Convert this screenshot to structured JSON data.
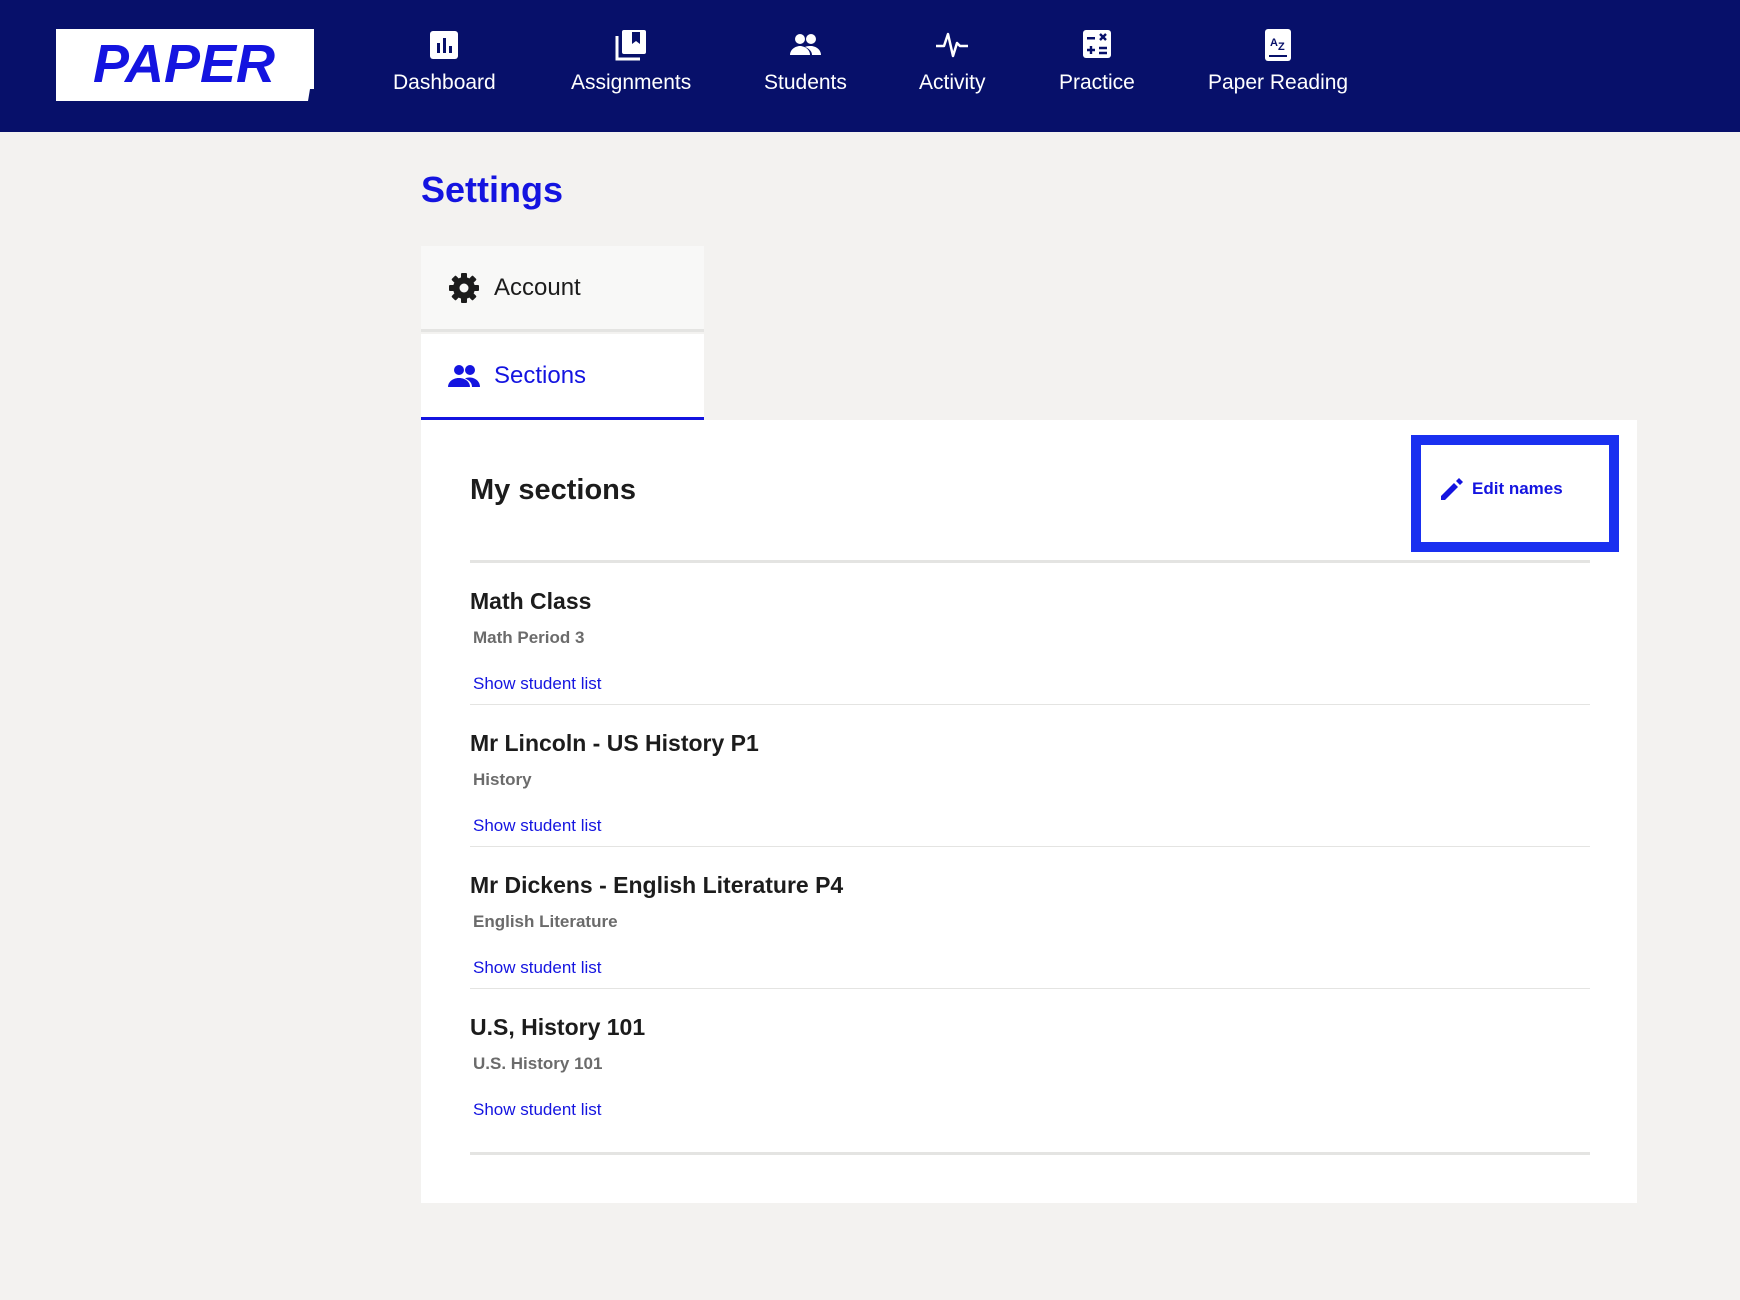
{
  "brand": {
    "logo_text": "PAPER"
  },
  "nav": {
    "items": [
      {
        "label": "Dashboard",
        "icon": "dashboard-chart-icon"
      },
      {
        "label": "Assignments",
        "icon": "assignments-book-icon"
      },
      {
        "label": "Students",
        "icon": "students-people-icon"
      },
      {
        "label": "Activity",
        "icon": "activity-pulse-icon"
      },
      {
        "label": "Practice",
        "icon": "practice-calculator-icon"
      },
      {
        "label": "Paper Reading",
        "icon": "reading-book-az-icon"
      }
    ]
  },
  "page": {
    "title": "Settings"
  },
  "settings_tabs": [
    {
      "label": "Account",
      "icon": "gear-icon",
      "active": false
    },
    {
      "label": "Sections",
      "icon": "people-icon",
      "active": true
    }
  ],
  "sections_panel": {
    "title": "My sections",
    "edit_button_label": "Edit names",
    "sections": [
      {
        "name": "Math Class",
        "subject": "Math Period 3",
        "link": "Show student list"
      },
      {
        "name": "Mr Lincoln - US History P1",
        "subject": "History",
        "link": "Show student list"
      },
      {
        "name": "Mr Dickens - English Literature P4",
        "subject": "English Literature",
        "link": "Show student list"
      },
      {
        "name": "U.S, History 101",
        "subject": "U.S. History 101",
        "link": "Show student list"
      }
    ]
  },
  "colors": {
    "topbar": "#07106a",
    "accent": "#1414e0",
    "highlight_border": "#1a30f0",
    "page_bg": "#f3f2f0"
  }
}
